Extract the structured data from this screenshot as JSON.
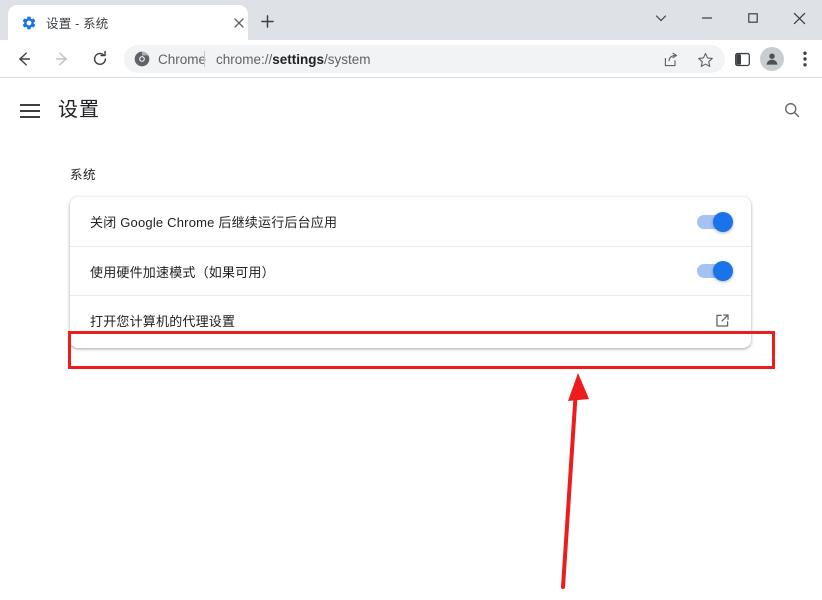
{
  "window": {
    "controls": [
      {
        "name": "chevron-down-button",
        "glyph": "∨"
      },
      {
        "name": "minimize-button",
        "glyph": "—"
      },
      {
        "name": "maximize-button",
        "glyph": "□"
      },
      {
        "name": "close-button",
        "glyph": "✕"
      }
    ]
  },
  "tabstrip": {
    "tab": {
      "title": "设置 - 系统",
      "favicon": "settings-gear-icon",
      "close_glyph": "✕"
    },
    "new_tab_glyph": "+",
    "new_tab_name": "new-tab-button"
  },
  "toolbar": {
    "back_name": "back-button",
    "forward_name": "forward-button",
    "reload_name": "reload-button",
    "omnibox": {
      "chrome_logo": "chrome-logo-icon",
      "label": "Chrome",
      "url_scheme": "chrome://",
      "url_host": "settings",
      "url_path": "/system",
      "full_url": "chrome://settings/system"
    },
    "share_name": "share-icon",
    "bookmark_name": "bookmark-star-icon",
    "side_panel_name": "side-panel-icon",
    "profile_name": "profile-avatar",
    "menu_name": "three-dot-menu-icon"
  },
  "settings": {
    "menu_button_label": "main-menu-button",
    "title": "设置",
    "search_label": "search-settings-icon",
    "section_heading": "系统",
    "rows": [
      {
        "label": "关闭 Google Chrome 后继续运行后台应用",
        "control": "toggle",
        "state": "on",
        "name": "background-apps-row"
      },
      {
        "label": "使用硬件加速模式（如果可用）",
        "control": "toggle",
        "state": "on",
        "name": "hardware-acceleration-row"
      },
      {
        "label": "打开您计算机的代理设置",
        "control": "external-link",
        "state": "",
        "name": "proxy-settings-row"
      }
    ]
  },
  "annotations": {
    "highlight_name": "red-highlight-rectangle",
    "arrow_name": "red-pointer-arrow",
    "color": "#ee1c1c"
  },
  "colors": {
    "accent_blue": "#1a73e8",
    "toggle_track": "#a5c3f2",
    "tabstrip_bg": "#dee1e6",
    "omnibox_bg": "#f1f3f4",
    "text_primary": "#202124",
    "text_secondary": "#5f6368",
    "annotation_red": "#ee1c1c"
  }
}
